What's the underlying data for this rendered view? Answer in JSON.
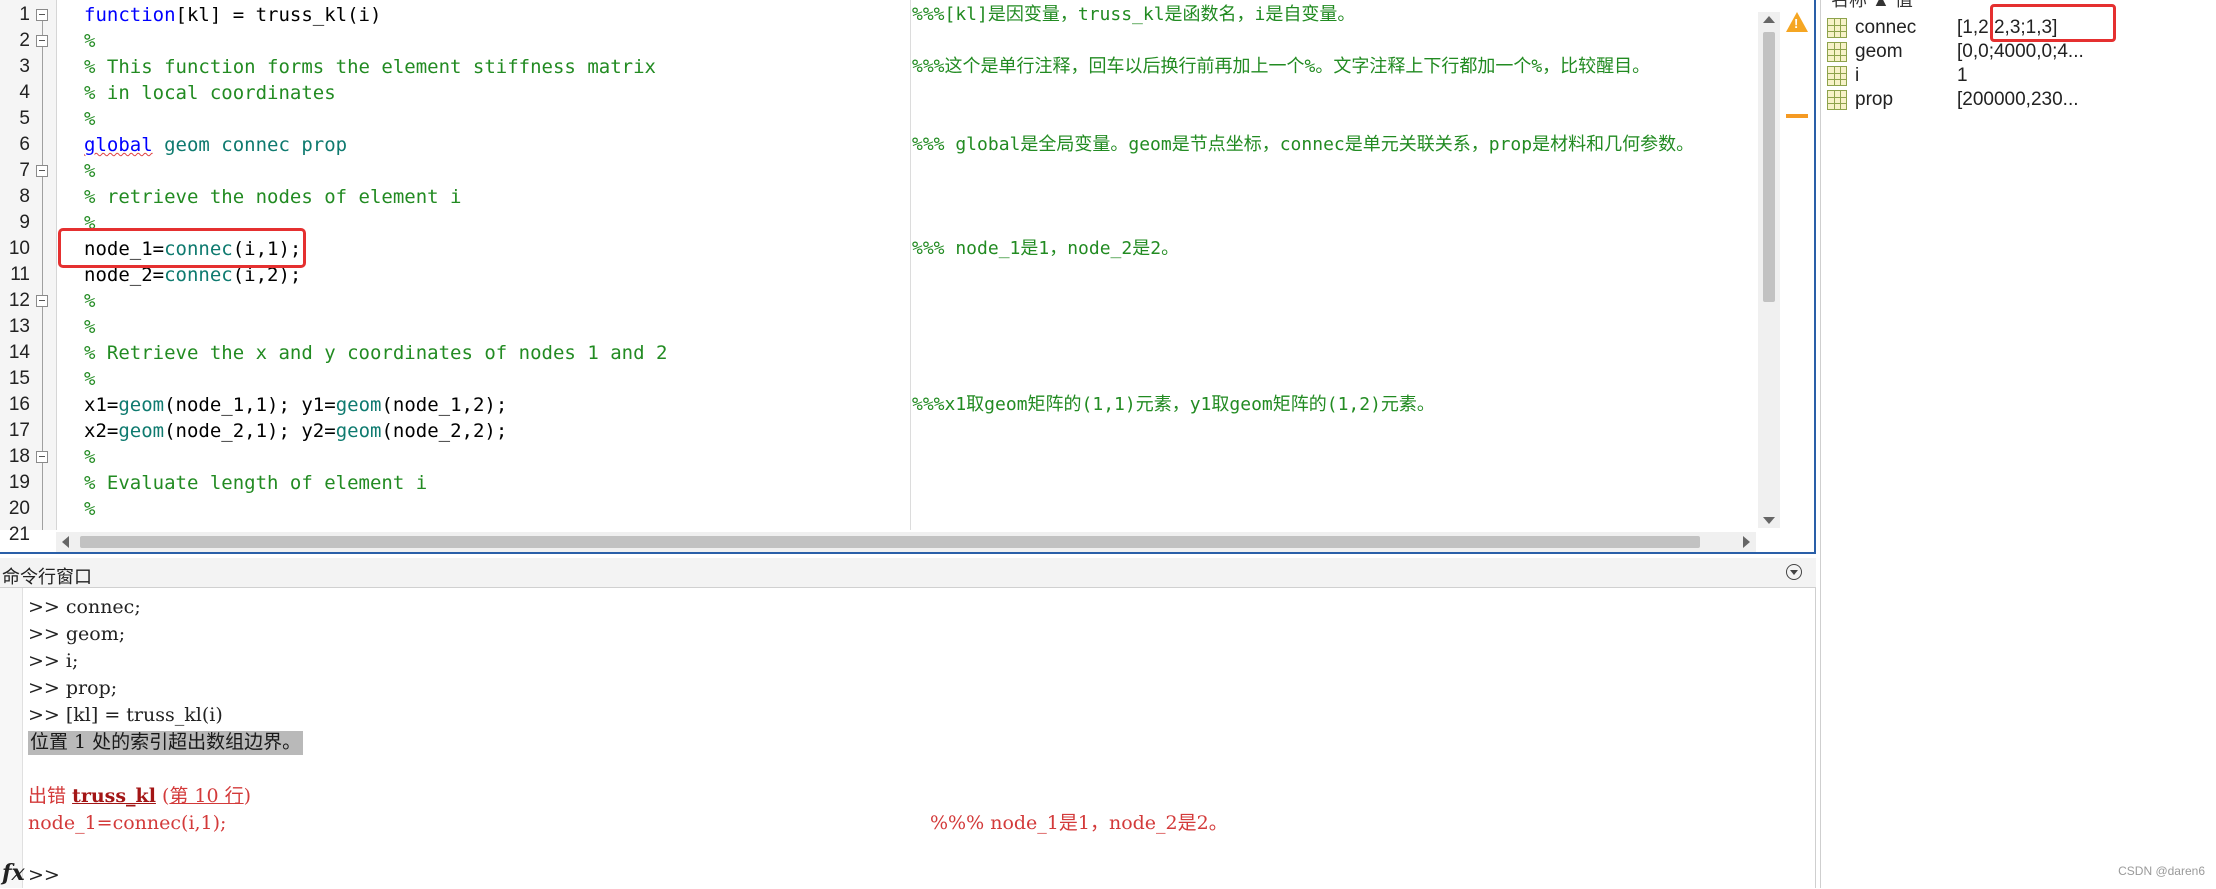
{
  "editor": {
    "line_numbers": [
      "1",
      "2",
      "3",
      "4",
      "5",
      "6",
      "7",
      "8",
      "9",
      "10",
      "11",
      "12",
      "13",
      "14",
      "15",
      "16",
      "17",
      "18",
      "19",
      "20",
      "21"
    ],
    "code": {
      "l1_kw": "function",
      "l1_rest": "[kl] = truss_kl(i)",
      "l2": "%",
      "l3": "% This function forms the element stiffness matrix",
      "l4": "% in local coordinates",
      "l5": "%",
      "l6_kw": "global",
      "l6_vars": " geom connec prop",
      "l7": "%",
      "l8": "% retrieve the nodes of element i",
      "l9": "%",
      "l10_a": "node_1=",
      "l10_fn": "connec",
      "l10_b": "(i,1);",
      "l11_a": "node_2=",
      "l11_fn": "connec",
      "l11_b": "(i,2);",
      "l12": "%",
      "l13": "%",
      "l14": "% Retrieve the x and y coordinates of nodes 1 and 2",
      "l15": "%",
      "l16_a": "x1=",
      "l16_fn1": "geom",
      "l16_b": "(node_1,1); y1=",
      "l16_fn2": "geom",
      "l16_c": "(node_1,2);",
      "l17_a": "x2=",
      "l17_fn1": "geom",
      "l17_b": "(node_2,1); y2=",
      "l17_fn2": "geom",
      "l17_c": "(node_2,2);",
      "l18": "%",
      "l19": "% Evaluate length of element i",
      "l20": "%"
    },
    "notes": {
      "n1": "%%%[kl]是因变量，truss_kl是函数名，i是自变量。",
      "n3": "%%%这个是单行注释，回车以后换行前再加上一个%。文字注释上下行都加一个%，比较醒目。",
      "n6": "%%% global是全局变量。geom是节点坐标，connec是单元关联关系，prop是材料和几何参数。",
      "n10": "%%% node_1是1，node_2是2。",
      "n16": "%%%x1取geom矩阵的(1,1)元素，y1取geom矩阵的(1,2)元素。"
    }
  },
  "workspace": {
    "header": "名称 ▲          值",
    "variables": [
      {
        "name": "connec",
        "value": "[1,2;2,3;1,3]"
      },
      {
        "name": "geom",
        "value": "[0,0;4000,0;4..."
      },
      {
        "name": "i",
        "value": "1"
      },
      {
        "name": "prop",
        "value": "[200000,230..."
      }
    ]
  },
  "command_window": {
    "title": "命令行窗口",
    "lines": [
      ">> connec;",
      ">> geom;",
      ">> i;",
      ">> prop;",
      ">> [kl] = truss_kl(i)"
    ],
    "error_message": "位置 1 处的索引超出数组边界。",
    "error_prefix": "出错 ",
    "error_link": "truss_kl",
    "error_location": "第 10 行",
    "error_code": "node_1=connec(i,1);",
    "error_note": "%%% node_1是1，node_2是2。",
    "prompt": ">>",
    "fx_label": "fx"
  },
  "watermark": "CSDN @daren6",
  "colors": {
    "keyword": "#0000ff",
    "comment": "#228b22",
    "global_var": "#0e7a6f",
    "highlight": "#e53030",
    "error_red": "#d33a3a"
  }
}
